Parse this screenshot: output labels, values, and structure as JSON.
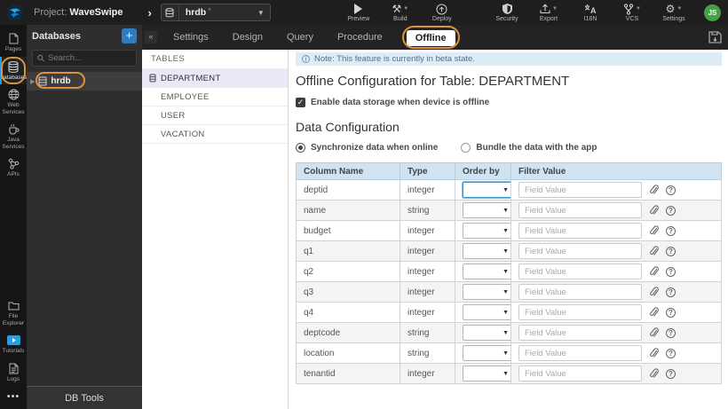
{
  "topbar": {
    "project_prefix": "Project:",
    "project_name": "WaveSwipe",
    "db_selector": {
      "value": "hrdb",
      "modified_mark": "*"
    },
    "actions_left": [
      {
        "label": "Preview",
        "icon": "play-icon",
        "has_caret": false
      },
      {
        "label": "Build",
        "icon": "hammer-icon",
        "has_caret": true
      },
      {
        "label": "Deploy",
        "icon": "cloud-upload-icon",
        "has_caret": false
      }
    ],
    "actions_right": [
      {
        "label": "Security",
        "icon": "shield-icon",
        "has_caret": false
      },
      {
        "label": "Export",
        "icon": "export-icon",
        "has_caret": true
      },
      {
        "label": "I18N",
        "icon": "translate-icon",
        "has_caret": false
      },
      {
        "label": "VCS",
        "icon": "branch-icon",
        "has_caret": true
      },
      {
        "label": "Settings",
        "icon": "gear-icon",
        "has_caret": true
      }
    ],
    "avatar_initials": "JS"
  },
  "sidebar": {
    "top_items": [
      {
        "label": "Pages",
        "icon": "page-icon",
        "active": false
      },
      {
        "label": "Databases",
        "icon": "database-icon",
        "active": true
      },
      {
        "label": "Web Services",
        "icon": "globe-icon",
        "active": false
      },
      {
        "label": "Java Services",
        "icon": "coffee-icon",
        "active": false
      },
      {
        "label": "APIs",
        "icon": "nodes-icon",
        "active": false
      }
    ],
    "bottom_items": [
      {
        "label": "File Explorer",
        "icon": "folder-icon"
      },
      {
        "label": "Tutorials",
        "icon": "video-play-icon"
      },
      {
        "label": "Logs",
        "icon": "document-icon"
      }
    ],
    "more_label": "•••"
  },
  "db_panel": {
    "title": "Databases",
    "add_button": "+",
    "search_placeholder": "Search...",
    "tree_item": "hrdb",
    "footer": "DB Tools"
  },
  "tabs": {
    "items": [
      "Settings",
      "Design",
      "Query",
      "Procedure",
      "Offline"
    ],
    "active": "Offline",
    "collapse_glyph": "«"
  },
  "tables_panel": {
    "title": "TABLES",
    "items": [
      "DEPARTMENT",
      "EMPLOYEE",
      "USER",
      "VACATION"
    ],
    "selected": "DEPARTMENT"
  },
  "content": {
    "note": "Note: This feature is currently in beta state.",
    "note_icon": "i",
    "title": "Offline Configuration for Table: DEPARTMENT",
    "enable_checkbox": {
      "checked": true,
      "label": "Enable data storage when device is offline"
    },
    "section_title": "Data Configuration",
    "radios": [
      {
        "label": "Synchronize data when online",
        "selected": true
      },
      {
        "label": "Bundle the data with the app",
        "selected": false
      }
    ],
    "table": {
      "headers": [
        "Column Name",
        "Type",
        "Order by",
        "Filter Value"
      ],
      "filter_placeholder": "Field Value",
      "rows": [
        {
          "name": "deptid",
          "type": "integer"
        },
        {
          "name": "name",
          "type": "string"
        },
        {
          "name": "budget",
          "type": "integer"
        },
        {
          "name": "q1",
          "type": "integer"
        },
        {
          "name": "q2",
          "type": "integer"
        },
        {
          "name": "q3",
          "type": "integer"
        },
        {
          "name": "q4",
          "type": "integer"
        },
        {
          "name": "deptcode",
          "type": "string"
        },
        {
          "name": "location",
          "type": "string"
        },
        {
          "name": "tenantid",
          "type": "integer"
        }
      ]
    }
  },
  "colors": {
    "accent_blue": "#2d7dc0",
    "annotation_orange": "#e0913c",
    "avatar_green": "#43a047",
    "table_header_blue": "#cfe3f2",
    "selected_row_lavender": "#eae8f6",
    "note_bg": "#dcedf8"
  }
}
